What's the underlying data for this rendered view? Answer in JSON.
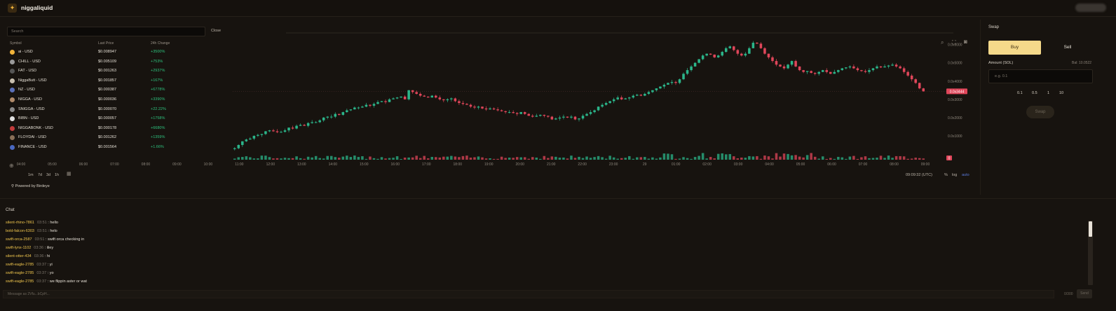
{
  "header": {
    "title": "niggaliquid",
    "logo_icon": "rocket-icon"
  },
  "markets": {
    "search_placeholder": "Search",
    "close_label": "Close",
    "columns": [
      "Symbol",
      "Last Price",
      "24h Change"
    ],
    "rows": [
      {
        "symbol": "ai - USD",
        "price": "$0.008947",
        "change": "+3500%",
        "color": "#f0b33a"
      },
      {
        "symbol": "CHILL - USD",
        "price": "$0.005109",
        "change": "+753%",
        "color": "#9a9a9a"
      },
      {
        "symbol": "FAT - USD",
        "price": "$0.001263",
        "change": "+2937%",
        "color": "#555555"
      },
      {
        "symbol": "NiggaButt - USD",
        "price": "$0.001857",
        "change": "+167%",
        "color": "#c9c0b0"
      },
      {
        "symbol": "NZ - USD",
        "price": "$0.000387",
        "change": "+6778%",
        "color": "#5a6fb8"
      },
      {
        "symbol": "NIGGA - USD",
        "price": "$0.000036",
        "change": "+3390%",
        "color": "#b08a6a"
      },
      {
        "symbol": "SNIGGA - USD",
        "price": "$0.000070",
        "change": "+22.22%",
        "color": "#888888"
      },
      {
        "symbol": "BIBN - USD",
        "price": "$0.000057",
        "change": "+1758%",
        "color": "#e0e0e0"
      },
      {
        "symbol": "NIGGABONK - USD",
        "price": "$0.000178",
        "change": "+6680%",
        "color": "#c23b3b"
      },
      {
        "symbol": "FLOYDAI - USD",
        "price": "$0.001262",
        "change": "+1359%",
        "color": "#8a7058"
      },
      {
        "symbol": "FINANCE - USD",
        "price": "$0.001564",
        "change": "+1.66%",
        "color": "#4a68c0"
      }
    ]
  },
  "chart_data": {
    "type": "candlestick",
    "x_ticks": [
      "04:00",
      "05:00",
      "06:00",
      "07:00",
      "08:00",
      "09:00",
      "10:00",
      "11:00",
      "12:00",
      "13:00",
      "14:00",
      "15:00",
      "16:00",
      "17:00",
      "18:00",
      "19:00",
      "20:00",
      "21:00",
      "22:00",
      "23:00",
      "29",
      "01:00",
      "02:00",
      "03:00",
      "04:00",
      "05:00",
      "06:00",
      "07:00",
      "08:00",
      "09:00"
    ],
    "y_ticks": [
      "0.0x6000",
      "0.0x5000",
      "0.0x4000",
      "0.0x3000",
      "0.0x2000",
      "0.0x1000"
    ],
    "last_price_label": "0.0x3444",
    "volume_label": "0",
    "close_series": [
      0.32,
      0.5,
      0.7,
      0.8,
      0.85,
      1.0,
      1.05,
      1.1,
      1.25,
      1.3,
      1.25,
      1.2,
      1.22,
      1.3,
      1.45,
      1.4,
      1.55,
      1.6,
      1.55,
      1.7,
      1.75,
      1.75,
      1.85,
      2.0,
      2.05,
      2.05,
      2.2,
      2.15,
      2.3,
      2.4,
      2.45,
      2.55,
      2.55,
      2.6,
      2.7,
      2.65,
      2.75,
      2.85,
      2.9,
      2.85,
      3.0,
      3.05,
      3.1,
      3.15,
      3.0,
      3.5,
      3.4,
      3.3,
      3.2,
      3.15,
      3.1,
      3.2,
      3.1,
      3.0,
      2.95,
      3.0,
      3.05,
      2.9,
      2.8,
      2.75,
      2.7,
      2.6,
      2.55,
      2.6,
      2.5,
      2.45,
      2.5,
      2.45,
      2.4,
      2.35,
      2.3,
      2.3,
      2.25,
      2.2,
      2.3,
      2.2,
      2.1,
      2.05,
      2.1,
      2.15,
      2.1,
      2.05,
      1.9,
      1.95,
      2.0,
      2.05,
      2.0,
      2.05,
      1.9,
      1.95,
      2.1,
      2.2,
      2.3,
      2.4,
      2.6,
      2.7,
      2.8,
      2.9,
      3.0,
      3.1,
      3.0,
      3.05,
      3.1,
      3.2,
      3.25,
      3.2,
      3.3,
      3.4,
      3.5,
      3.6,
      3.7,
      3.8,
      3.9,
      3.95,
      3.9,
      4.1,
      4.4,
      4.6,
      4.8,
      5.0,
      5.2,
      5.4,
      5.5,
      5.45,
      5.3,
      5.4,
      5.6,
      5.8,
      5.9,
      5.7,
      5.5,
      5.4,
      5.5,
      5.8,
      6.1,
      6.05,
      5.8,
      5.5,
      5.3,
      5.1,
      4.9,
      4.8,
      4.7,
      4.9,
      5.1,
      4.8,
      4.6,
      4.5,
      4.55,
      4.45,
      4.4,
      4.5,
      4.6,
      4.5,
      4.4,
      4.5,
      4.6,
      4.7,
      4.75,
      4.8,
      4.7,
      4.6,
      4.55,
      4.5,
      4.6,
      4.7,
      4.8,
      4.75,
      4.8,
      4.85,
      4.9,
      4.8,
      4.7,
      4.5,
      4.3,
      4.1,
      3.9,
      3.6,
      3.44
    ]
  },
  "chart_ui": {
    "periods": [
      "1m",
      "7d",
      "3d",
      "1h"
    ],
    "time_readout": "09:09:32 (UTC)",
    "percent_label": "%",
    "log_label": "log",
    "auto_label": "auto",
    "powered_by": "Powered by Birdeye",
    "zoom_icon": "zoom-in-icon",
    "fullscreen_icon": "fullscreen-icon",
    "camera_icon": "camera-icon",
    "calendar_icon": "calendar-icon",
    "colors": {
      "up": "#2bb58a",
      "down": "#e0465a"
    }
  },
  "swap": {
    "title": "Swap",
    "buy_label": "Buy",
    "sell_label": "Sell",
    "amount_label": "Amount (SOL)",
    "balance_label": "Bal: 10.0522",
    "amount_placeholder": "e.g. 0.1",
    "presets": [
      "0.1",
      "0.5",
      "1",
      "10"
    ],
    "submit_label": "Swap"
  },
  "chat": {
    "title": "Chat",
    "messages": [
      {
        "user": "silent-rhino-7861",
        "time": "03:51",
        "text": "hello"
      },
      {
        "user": "bold-falcon-6303",
        "time": "03:51",
        "text": "helo"
      },
      {
        "user": "swift-orca-2587",
        "time": "03:51",
        "text": "swift orca checking in"
      },
      {
        "user": "swift-lynx-1102",
        "time": "03:36",
        "text": "iliey"
      },
      {
        "user": "silent-otter-434",
        "time": "03:36",
        "text": "hi"
      },
      {
        "user": "swift-eagle-2785",
        "time": "03:37",
        "text": "yi"
      },
      {
        "user": "swift-eagle-2785",
        "time": "03:37",
        "text": "yo"
      },
      {
        "user": "swift-eagle-2785",
        "time": "03:37",
        "text": "we flippin aster or wat"
      }
    ],
    "input_placeholder": "Message as 2Vfu...bCpH...",
    "char_count": "0/300",
    "send_label": "Send"
  }
}
